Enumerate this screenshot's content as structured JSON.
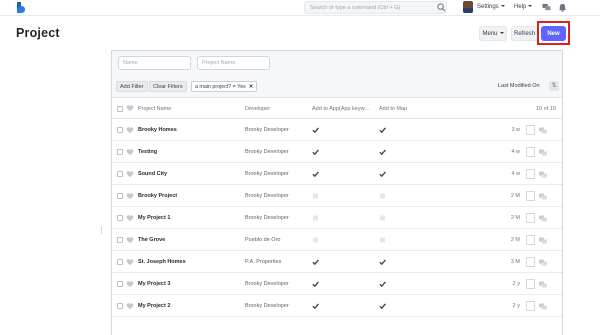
{
  "navbar": {
    "search_placeholder": "Search or type a command (Ctrl + G)",
    "settings_label": "Settings",
    "help_label": "Help"
  },
  "page": {
    "title": "Project",
    "menu_label": "Menu",
    "refresh_label": "Refresh",
    "new_label": "New"
  },
  "filters": {
    "name_placeholder": "Name",
    "project_name_placeholder": "Project Name",
    "add_filter_label": "Add Filter",
    "clear_filters_label": "Clear Filters",
    "active_filter": "a main project? = Yes",
    "sort_label": "Last Modified On"
  },
  "table": {
    "columns": [
      "Project Name",
      "Developer",
      "Add to App(App keyw...",
      "Add to Map"
    ],
    "count": "10 of 10",
    "rows": [
      {
        "name": "Brooky Homes",
        "developer": "Brooky Developer",
        "add_to_app": true,
        "add_to_map": true,
        "modified": "3 w"
      },
      {
        "name": "Testing",
        "developer": "Brooky Developer",
        "add_to_app": true,
        "add_to_map": true,
        "modified": "4 w"
      },
      {
        "name": "Sound City",
        "developer": "Brooky Developer",
        "add_to_app": true,
        "add_to_map": true,
        "modified": "4 w"
      },
      {
        "name": "Brooky Project",
        "developer": "Brooky Developer",
        "add_to_app": false,
        "add_to_map": false,
        "modified": "2 M"
      },
      {
        "name": "My Project 1",
        "developer": "Brooky Developer",
        "add_to_app": false,
        "add_to_map": false,
        "modified": "2 M"
      },
      {
        "name": "The Grove",
        "developer": "Pueblo de Oro",
        "add_to_app": false,
        "add_to_map": false,
        "modified": "2 M"
      },
      {
        "name": "St. Joseph Homes",
        "developer": "P.A. Properties",
        "add_to_app": true,
        "add_to_map": true,
        "modified": "3 M"
      },
      {
        "name": "My Project 3",
        "developer": "Brooky Developer",
        "add_to_app": true,
        "add_to_map": true,
        "modified": "2 y"
      },
      {
        "name": "My Project 2",
        "developer": "Brooky Developer",
        "add_to_app": true,
        "add_to_map": true,
        "modified": "2 y"
      }
    ]
  },
  "colors": {
    "primary": "#5e64ff",
    "highlight": "#e02020",
    "brand": "#2c7be5"
  },
  "icons": {
    "logo": "brand-logo-icon",
    "search": "search-icon",
    "chat": "chat-icon",
    "bell": "bell-icon",
    "heart": "heart-icon",
    "check": "check-icon",
    "comment": "comment-icon"
  }
}
